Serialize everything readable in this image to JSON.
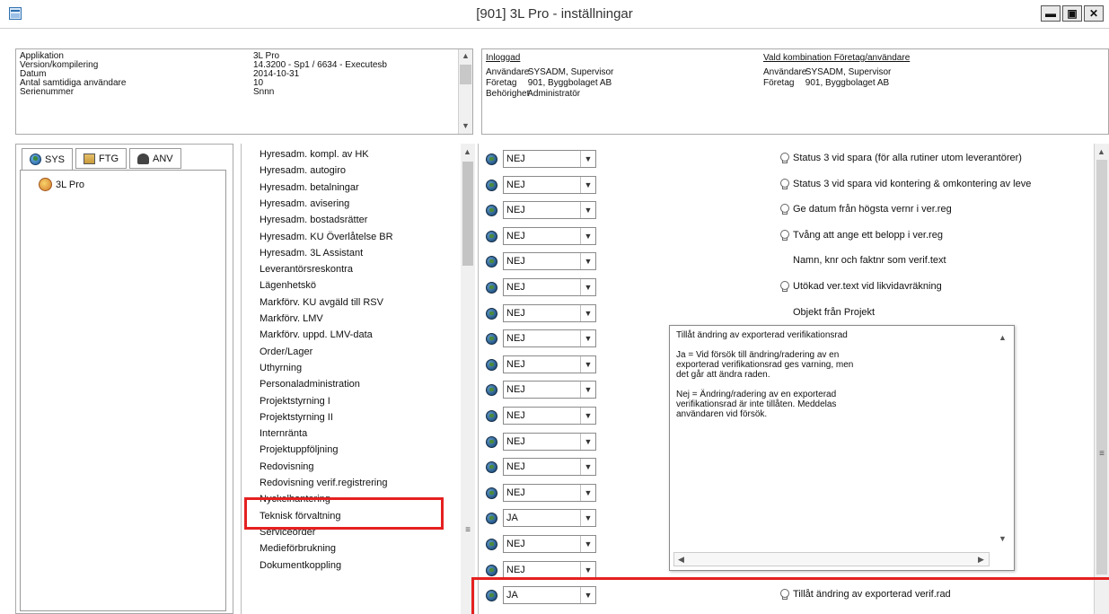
{
  "window": {
    "title": "[901]  3L Pro - inställningar",
    "min_label": "▬",
    "max_label": "▣",
    "close_label": "✕"
  },
  "info": {
    "labels": [
      "Applikation",
      "Version/kompilering",
      "Datum",
      "Antal samtidiga användare",
      "Serienummer"
    ],
    "values": [
      "3L Pro",
      "14.3200 - Sp1 / 6634 - Executesb",
      "2014-10-31",
      "10",
      "Snnn"
    ]
  },
  "login": {
    "heading": "Inloggad",
    "combo_heading": "Vald kombination Företag/användare",
    "rows": [
      {
        "label": "Användare",
        "value": "SYSADM, Supervisor"
      },
      {
        "label": "Företag",
        "value": "901, Byggbolaget AB"
      },
      {
        "label": "Behörighet",
        "value": "Administratör"
      }
    ],
    "combo_rows": [
      {
        "label": "Användare",
        "value": "SYSADM, Supervisor"
      },
      {
        "label": "Företag",
        "value": "901, Byggbolaget AB"
      }
    ]
  },
  "tabs": [
    {
      "label": "SYS"
    },
    {
      "label": "FTG"
    },
    {
      "label": "ANV"
    }
  ],
  "tree": {
    "item": "3L Pro"
  },
  "modules": [
    "Hyresadm. kompl. av HK",
    "Hyresadm. autogiro",
    "Hyresadm. betalningar",
    "Hyresadm. avisering",
    "Hyresadm. bostadsrätter",
    "Hyresadm. KU Överlåtelse BR",
    "Hyresadm. 3L Assistant",
    "Leverantörsreskontra",
    "Lägenhetskö",
    "Markförv. KU avgäld till RSV",
    "Markförv. LMV",
    "Markförv. uppd. LMV-data",
    "Order/Lager",
    "Uthyrning",
    "Personaladministration",
    "Projektstyrning I",
    "Projektstyrning II",
    "Internränta",
    "Projektuppföljning",
    "Redovisning",
    "Redovisning verif.registrering",
    "Nyckelhantering",
    "Teknisk förvaltning",
    "Serviceorder",
    "Medieförbrukning",
    "Dokumentkoppling"
  ],
  "settings": [
    {
      "value": "NEJ",
      "desc": "Status 3 vid spara (för alla rutiner utom leverantörer)",
      "hint": true
    },
    {
      "value": "NEJ",
      "desc": "Status 3 vid spara vid kontering & omkontering av leve",
      "hint": true
    },
    {
      "value": "NEJ",
      "desc": "Ge datum från högsta vernr i ver.reg",
      "hint": true
    },
    {
      "value": "NEJ",
      "desc": "Tvång att ange ett belopp i ver.reg",
      "hint": true
    },
    {
      "value": "NEJ",
      "desc": "Namn, knr och faktnr som verif.text",
      "hint": false
    },
    {
      "value": "NEJ",
      "desc": "Utökad ver.text vid likvidavräkning",
      "hint": true
    },
    {
      "value": "NEJ",
      "desc": "Objekt från Projekt",
      "hint": false
    },
    {
      "value": "NEJ",
      "desc": "",
      "hint": false
    },
    {
      "value": "NEJ",
      "desc": "",
      "hint": false
    },
    {
      "value": "NEJ",
      "desc": "",
      "hint": false
    },
    {
      "value": "NEJ",
      "desc": "",
      "hint": false
    },
    {
      "value": "NEJ",
      "desc": "",
      "hint": false
    },
    {
      "value": "NEJ",
      "desc": "",
      "hint": false
    },
    {
      "value": "NEJ",
      "desc": "",
      "hint": false
    },
    {
      "value": "JA",
      "desc": "",
      "hint": false
    },
    {
      "value": "NEJ",
      "desc": "",
      "hint": false
    },
    {
      "value": "NEJ",
      "desc": "",
      "hint": false
    },
    {
      "value": "JA",
      "desc": "Tillåt ändring av exporterad verif.rad",
      "hint": true
    }
  ],
  "tooltip": {
    "text": "Tillåt ändring av exporterad verifikationsrad\n\nJa = Vid försök till ändring/radering av en\nexporterad verifikationsrad ges varning, men\ndet går att ändra raden.\n\nNej = Ändring/radering av en exporterad\nverifikationsrad är inte tillåten. Meddelas\nanvändaren vid försök."
  },
  "colors": {
    "highlight": "#e52020"
  }
}
